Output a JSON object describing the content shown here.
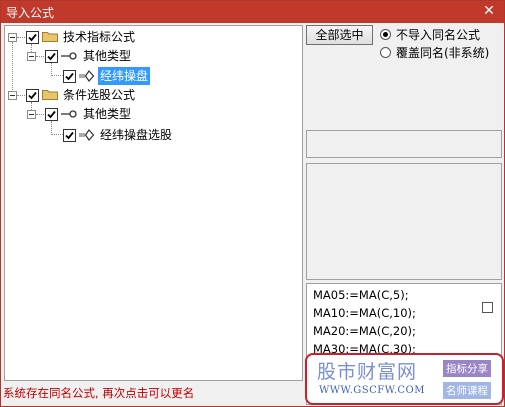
{
  "window": {
    "title": "导入公式",
    "close_glyph": "✕"
  },
  "tree": {
    "root1": {
      "label": "技术指标公式",
      "checked": true
    },
    "root1_child": {
      "label": "其他类型",
      "checked": true
    },
    "root1_leaf": {
      "label": "经纬操盘",
      "checked": true,
      "selected": true
    },
    "root2": {
      "label": "条件选股公式",
      "checked": true
    },
    "root2_child": {
      "label": "其他类型",
      "checked": true
    },
    "root2_leaf": {
      "label": "经纬操盘选股",
      "checked": true
    }
  },
  "controls": {
    "select_all_label": "全部选中",
    "radio_no_import_label": "不导入同名公式",
    "radio_overwrite_label": "覆盖同名(非系统)",
    "radio_selected": "no_import"
  },
  "code_preview": {
    "lines": [
      "MA05:=MA(C,5);",
      "MA10:=MA(C,10);",
      "MA20:=MA(C,20);",
      "MA30:=MA(C,30);"
    ]
  },
  "status_text": "系统存在同名公式, 再次点击可以更名",
  "watermark": {
    "title": "股市财富网",
    "url": "WWW.GSCFW.COM",
    "tag1": "指标分享",
    "tag2": "名师课程"
  },
  "colors": {
    "titlebar": "#c0392b",
    "selection": "#3399ff",
    "status": "#c00000",
    "watermark_border": "#cc1f2d"
  },
  "icons": {
    "folder": "folder-icon",
    "key": "key-icon",
    "formula": "formula-icon",
    "close": "close-icon"
  }
}
